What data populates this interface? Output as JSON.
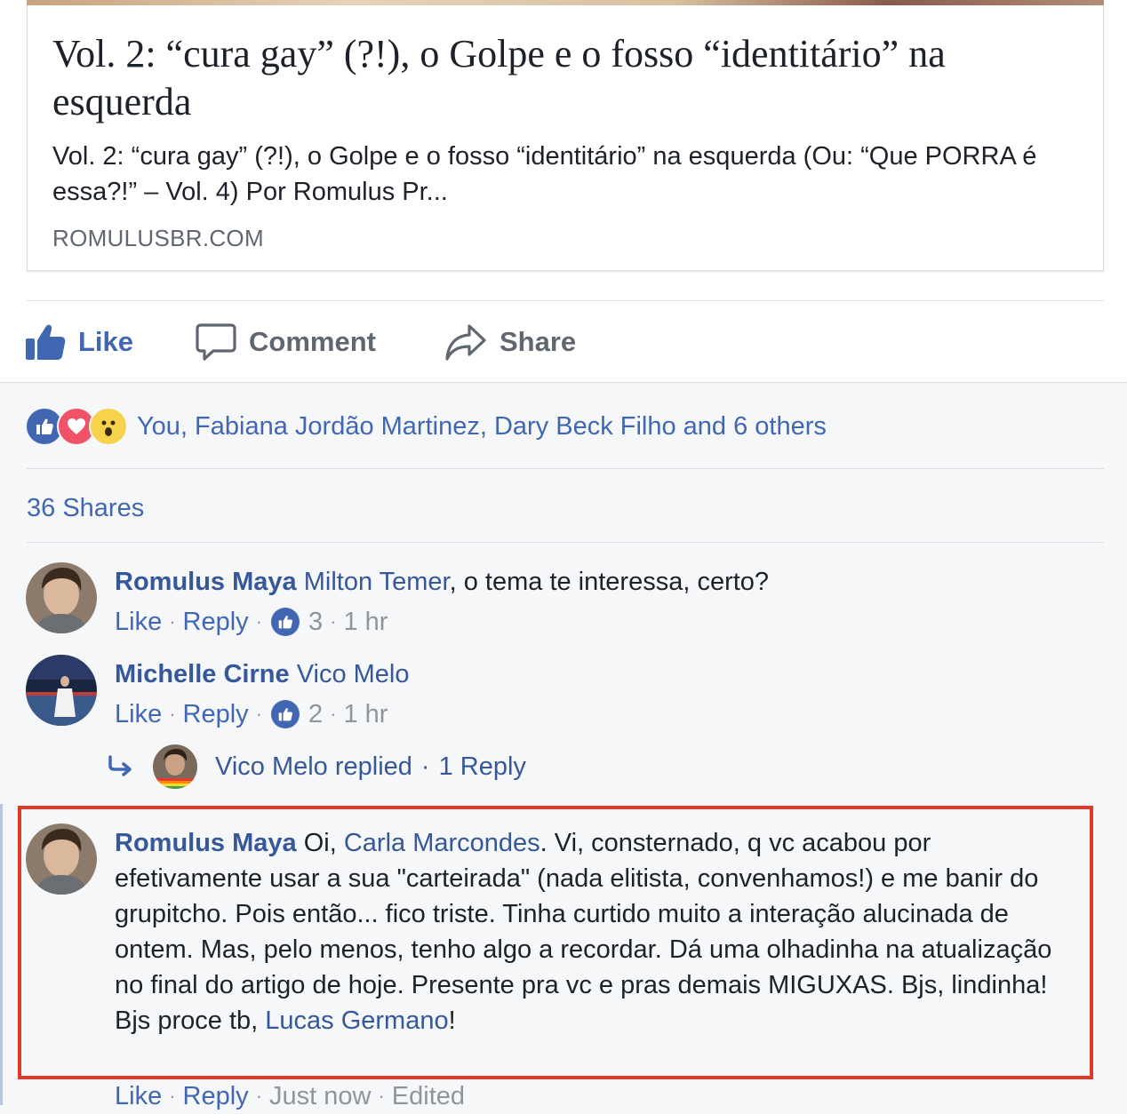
{
  "link_card": {
    "title": "Vol. 2: “cura gay” (?!), o Golpe e o fosso “identitário” na esquerda",
    "description": "Vol. 2: “cura gay” (?!), o Golpe e o fosso “identitário” na esquerda (Ou: “Que PORRA é essa?!” – Vol. 4) Por Romulus Pr...",
    "domain": "ROMULUSBR.COM"
  },
  "actions": {
    "like": "Like",
    "comment": "Comment",
    "share": "Share"
  },
  "reactions": {
    "icons": [
      "like-reaction-icon",
      "love-reaction-icon",
      "wow-reaction-icon"
    ],
    "summary": "You, Fabiana Jordão Martinez, Dary Beck Filho and 6 others"
  },
  "shares_count": "36 Shares",
  "comments": [
    {
      "author": "Romulus Maya",
      "mention": "Milton Temer",
      "text": ", o tema te interessa, certo?",
      "like_label": "Like",
      "reply_label": "Reply",
      "likes": "3",
      "time": "1 hr"
    },
    {
      "author": "Michelle Cirne",
      "mention": "Vico Melo",
      "text": "",
      "like_label": "Like",
      "reply_label": "Reply",
      "likes": "2",
      "time": "1 hr"
    }
  ],
  "reply_summary": {
    "name": "Vico Melo replied",
    "sep": "·",
    "count": "1 Reply"
  },
  "highlighted_comment": {
    "author": "Romulus Maya",
    "part1": " Oi, ",
    "mention1": "Carla Marcondes",
    "part2": ". Vi, consternado, q vc acabou por efetivamente usar a sua \"carteirada\" (nada elitista, convenhamos!) e me banir do grupitcho. Pois então... fico triste. Tinha curtido muito a interação alucinada de ontem. Mas, pelo menos, tenho algo a recordar. Dá uma olhadinha na atualização no final do artigo de hoje. Presente pra vc e pras demais MIGUXAS. Bjs, lindinha!",
    "part3": "Bjs proce tb, ",
    "mention2": "Lucas Germano",
    "part4": "!",
    "like_label": "Like",
    "reply_label": "Reply",
    "time": "Just now",
    "edited": "Edited"
  },
  "colors": {
    "link_blue": "#4267b2",
    "name_blue": "#365899",
    "highlight_red": "#e0382a",
    "meta_gray": "#90949c"
  }
}
